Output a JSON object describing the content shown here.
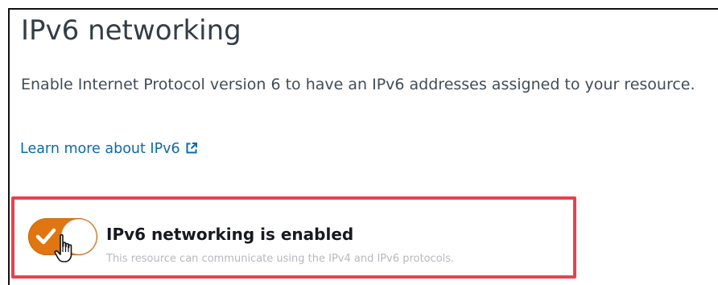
{
  "section": {
    "title": "IPv6 networking",
    "description": "Enable Internet Protocol version 6 to have an IPv6 addresses assigned to your resource.",
    "learn_more_link": "Learn more about IPv6"
  },
  "toggle": {
    "state": "on",
    "label": "IPv6 networking is enabled",
    "description": "This resource can communicate using the IPv4 and IPv6 protocols."
  },
  "icons": {
    "external_link": "external-link-icon",
    "check": "check-icon",
    "cursor": "hand-pointer-icon"
  },
  "colors": {
    "toggle_on": "#e07612",
    "link": "#0f6aa6",
    "highlight": "#e5434f"
  }
}
